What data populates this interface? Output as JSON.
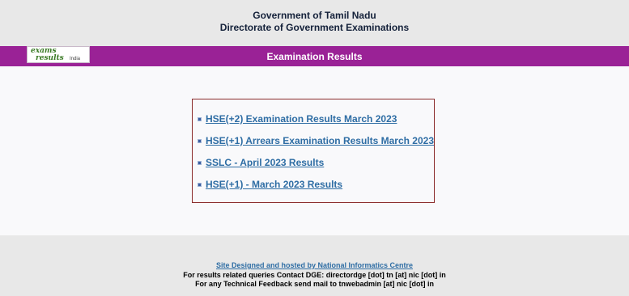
{
  "header": {
    "line1": "Government of Tamil Nadu",
    "line2": "Directorate of Government Examinations"
  },
  "banner": {
    "logo": {
      "line1": "exams",
      "line2": "results",
      "suffix": "India"
    },
    "title": "Examination Results"
  },
  "results": {
    "items": [
      {
        "label": "HSE(+2) Examination Results March 2023"
      },
      {
        "label": "HSE(+1) Arrears Examination Results March 2023"
      },
      {
        "label": "SSLC - April 2023 Results"
      },
      {
        "label": "HSE(+1) - March 2023 Results"
      }
    ]
  },
  "footer": {
    "credit_link": "Site Designed and hosted by National Informatics Centre",
    "contact": "For results related queries Contact DGE:  directordge [dot] tn [at] nic [dot] in",
    "feedback": "For any Technical Feedback send mail to tnwebadmin [at] nic [dot] in"
  },
  "colors": {
    "banner": "#9a2296",
    "link": "#2e6da4",
    "box_border": "#8a2a2a",
    "header_bg": "#e8e8e8"
  }
}
